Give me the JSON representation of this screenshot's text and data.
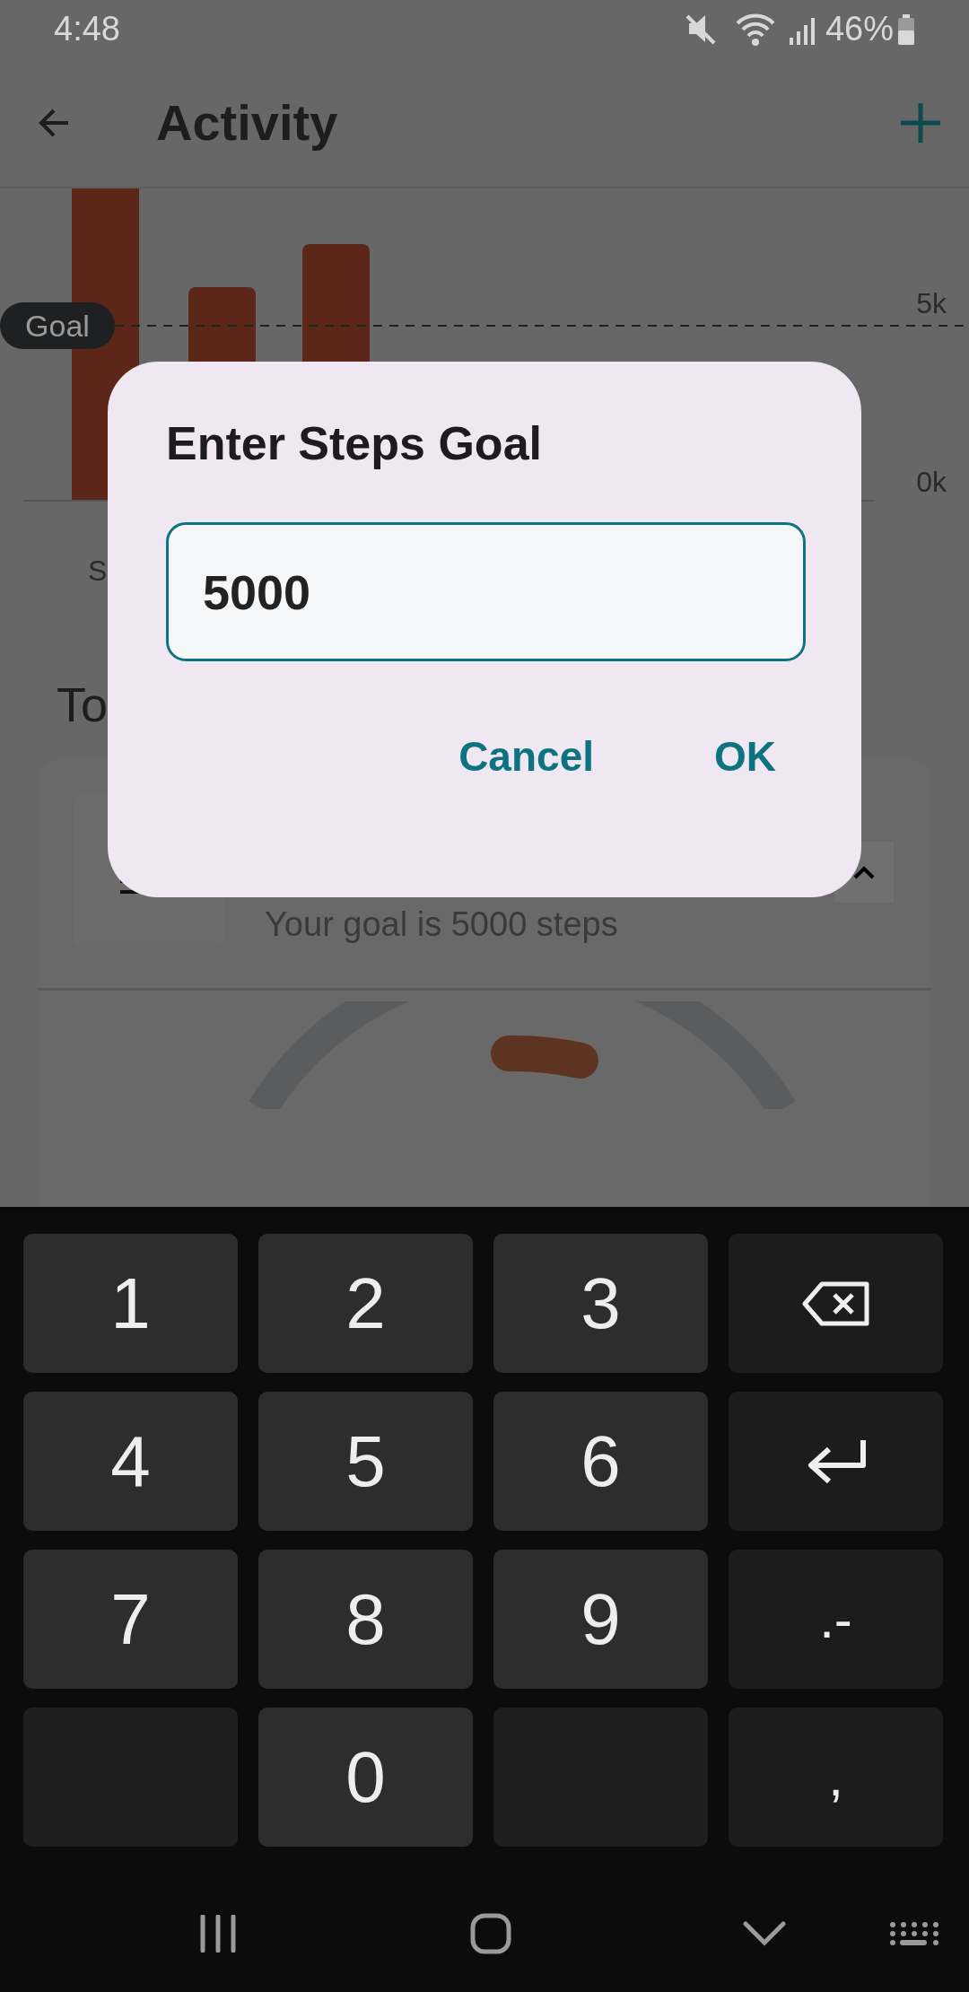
{
  "status_bar": {
    "time": "4:48",
    "battery": "46%"
  },
  "app_bar": {
    "title": "Activity"
  },
  "chart": {
    "axis_labels": [
      "5k",
      "0k"
    ],
    "goal_label": "Goal",
    "partial_day_label": "S"
  },
  "section_heading": "To",
  "goal_card": {
    "subtitle": "Your goal is 5000 steps",
    "expanded": true
  },
  "dialog": {
    "title": "Enter Steps Goal",
    "field_value": "5000",
    "buttons": [
      "Cancel",
      "OK"
    ]
  },
  "keyboard": {
    "keys": [
      {
        "kind": "text",
        "label": "1"
      },
      {
        "kind": "text",
        "label": "2"
      },
      {
        "kind": "text",
        "label": "3"
      },
      {
        "kind": "backspace"
      },
      {
        "kind": "text",
        "label": "4"
      },
      {
        "kind": "text",
        "label": "5"
      },
      {
        "kind": "text",
        "label": "6"
      },
      {
        "kind": "enter"
      },
      {
        "kind": "text",
        "label": "7"
      },
      {
        "kind": "text",
        "label": "8"
      },
      {
        "kind": "text",
        "label": "9"
      },
      {
        "kind": "symbol",
        "label": ".-"
      },
      {
        "kind": "blank"
      },
      {
        "kind": "text",
        "label": "0"
      },
      {
        "kind": "blank"
      },
      {
        "kind": "symbol",
        "label": ","
      }
    ]
  }
}
